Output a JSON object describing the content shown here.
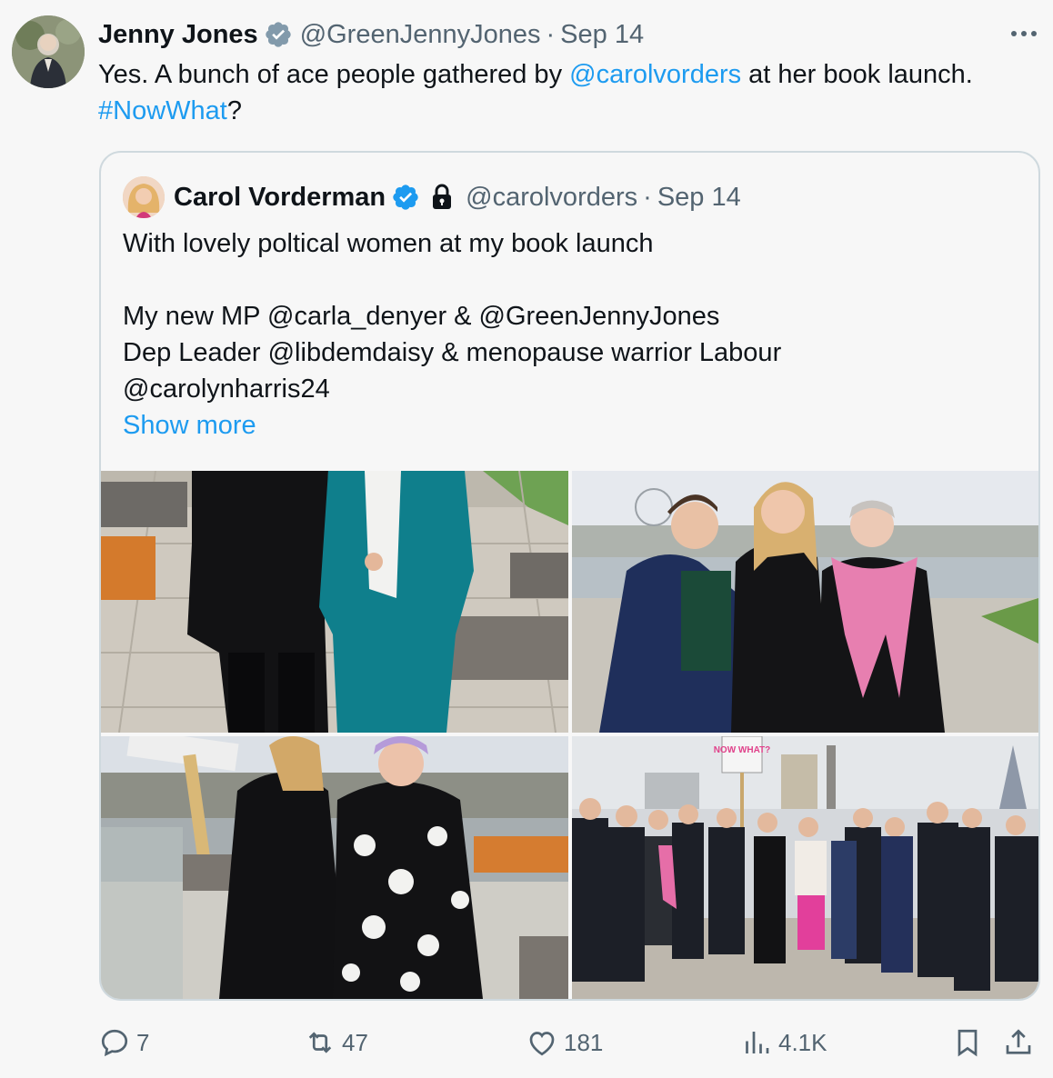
{
  "tweet": {
    "author_name": "Jenny Jones",
    "handle": "@GreenJennyJones",
    "separator": "·",
    "date": "Sep 14",
    "text_before": "Yes. A bunch of ace people gathered by ",
    "mention": "@carolvorders",
    "text_after": " at her book launch.",
    "hashtag": "#NowWhat",
    "text_end": "?",
    "more_icon": "more-dots-icon"
  },
  "quote": {
    "author_name": "Carol Vorderman",
    "handle": "@carolvorders",
    "separator": "·",
    "date": "Sep 14",
    "line1": "With lovely poltical women at my book launch",
    "line2": "My new MP @carla_denyer & @GreenJennyJones",
    "line3": "Dep Leader @libdemdaisy & menopause warrior Labour",
    "line4": "@carolynharris24",
    "show_more": "Show more",
    "sign_text": "NOW WHAT?"
  },
  "actions": {
    "replies": "7",
    "reposts": "47",
    "likes": "181",
    "views": "4.1K"
  },
  "colors": {
    "accent": "#1d9bf0",
    "muted": "#536471",
    "border": "#cfd9de"
  }
}
